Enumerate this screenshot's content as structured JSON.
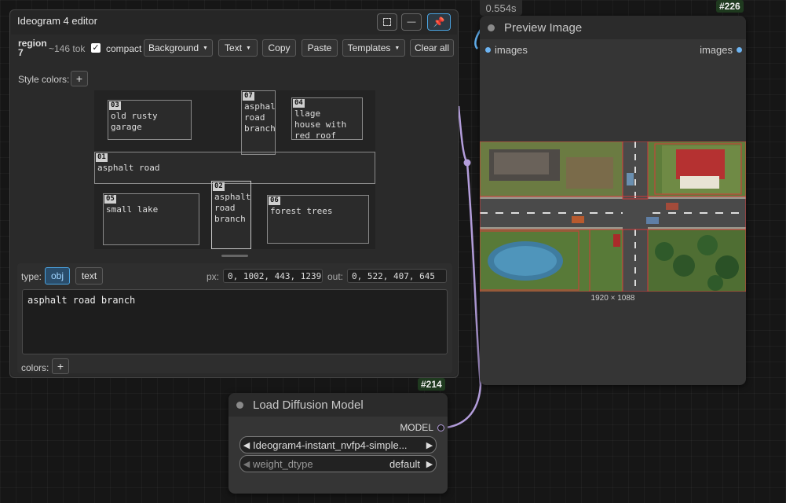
{
  "timing": "0.554s",
  "preview_node": {
    "id": "#226",
    "title": "Preview Image",
    "input_label": "images",
    "output_label": "images",
    "dimensions": "1920 × 1088"
  },
  "load_node": {
    "id": "#214",
    "title": "Load Diffusion Model",
    "output_label": "MODEL",
    "model_value": "Ideogram4-instant_nvfp4-simple...",
    "dtype_label": "weight_dtype",
    "dtype_value": "default"
  },
  "editor": {
    "title": "Ideogram 4 editor",
    "region_label": "region",
    "region_number": "7",
    "token_count": "~146 tok",
    "compact_label": "compact",
    "compact_checked": true,
    "toolbar": {
      "background": "Background",
      "text": "Text",
      "copy": "Copy",
      "paste": "Paste",
      "templates": "Templates",
      "clear_all": "Clear all"
    },
    "style_colors_label": "Style colors:",
    "add_symbol": "+",
    "regions": [
      {
        "id": "03",
        "text": "old rusty\ngarage"
      },
      {
        "id": "07",
        "text": "asphal\nroad\nbranch"
      },
      {
        "id": "04",
        "text": "llage\nhouse with\nred roof"
      },
      {
        "id": "01",
        "text": "asphalt road"
      },
      {
        "id": "05",
        "text": "small lake"
      },
      {
        "id": "02",
        "text": "asphalt\nroad\nbranch"
      },
      {
        "id": "06",
        "text": "forest trees"
      }
    ],
    "type_label": "type:",
    "type_obj": "obj",
    "type_text": "text",
    "px_label": "px:",
    "px_value": "0, 1002, 443, 1239",
    "out_label": "out:",
    "out_value": "0, 522, 407, 645",
    "prompt_value": "asphalt road branch",
    "colors_label": "colors:"
  },
  "colors": {
    "accent": "#4aa3e0",
    "wire_model": "#b39ddb",
    "wire_image": "#64b5f6"
  }
}
